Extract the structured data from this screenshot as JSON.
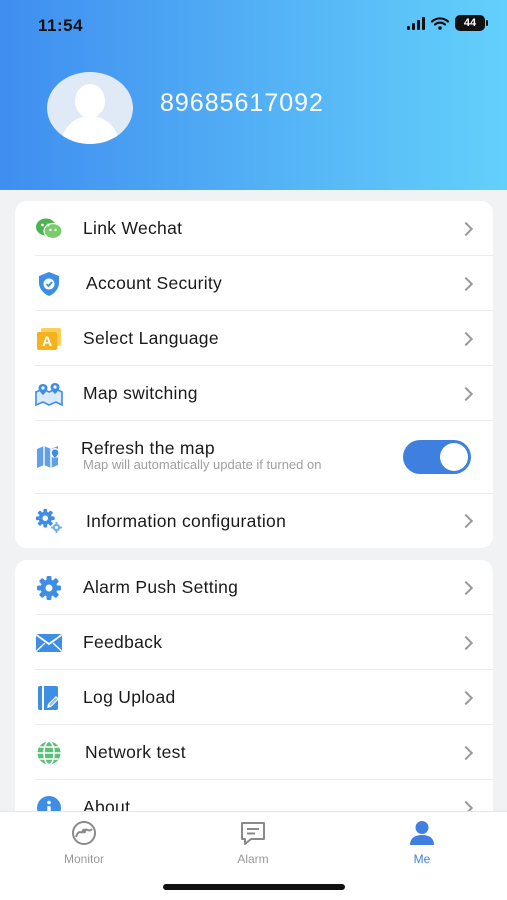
{
  "status_bar": {
    "time": "11:54",
    "battery": "44"
  },
  "profile": {
    "user_id": "89685617092"
  },
  "colors": {
    "accent": "#3f7fe0",
    "header_start": "#3f8ef0",
    "header_end": "#63d0fb"
  },
  "menu_group_1": [
    {
      "label": "Link Wechat",
      "icon": "wechat-icon"
    },
    {
      "label": "Account Security",
      "icon": "shield-icon"
    },
    {
      "label": "Select Language",
      "icon": "language-icon"
    },
    {
      "label": "Map switching",
      "icon": "map-switch-icon"
    },
    {
      "label": "Refresh the map",
      "subtitle": "Map will automatically update if turned on",
      "icon": "map-refresh-icon",
      "toggle_on": true
    },
    {
      "label": "Information configuration",
      "icon": "gears-icon"
    }
  ],
  "menu_group_2": [
    {
      "label": "Alarm Push Setting",
      "icon": "gear-icon"
    },
    {
      "label": "Feedback",
      "icon": "envelope-icon"
    },
    {
      "label": "Log Upload",
      "icon": "log-upload-icon"
    },
    {
      "label": "Network test",
      "icon": "globe-icon"
    },
    {
      "label": "About",
      "icon": "info-icon"
    }
  ],
  "tabbar": [
    {
      "label": "Monitor",
      "icon": "monitor-icon",
      "active": false
    },
    {
      "label": "Alarm",
      "icon": "alarm-message-icon",
      "active": false
    },
    {
      "label": "Me",
      "icon": "person-icon",
      "active": true
    }
  ]
}
